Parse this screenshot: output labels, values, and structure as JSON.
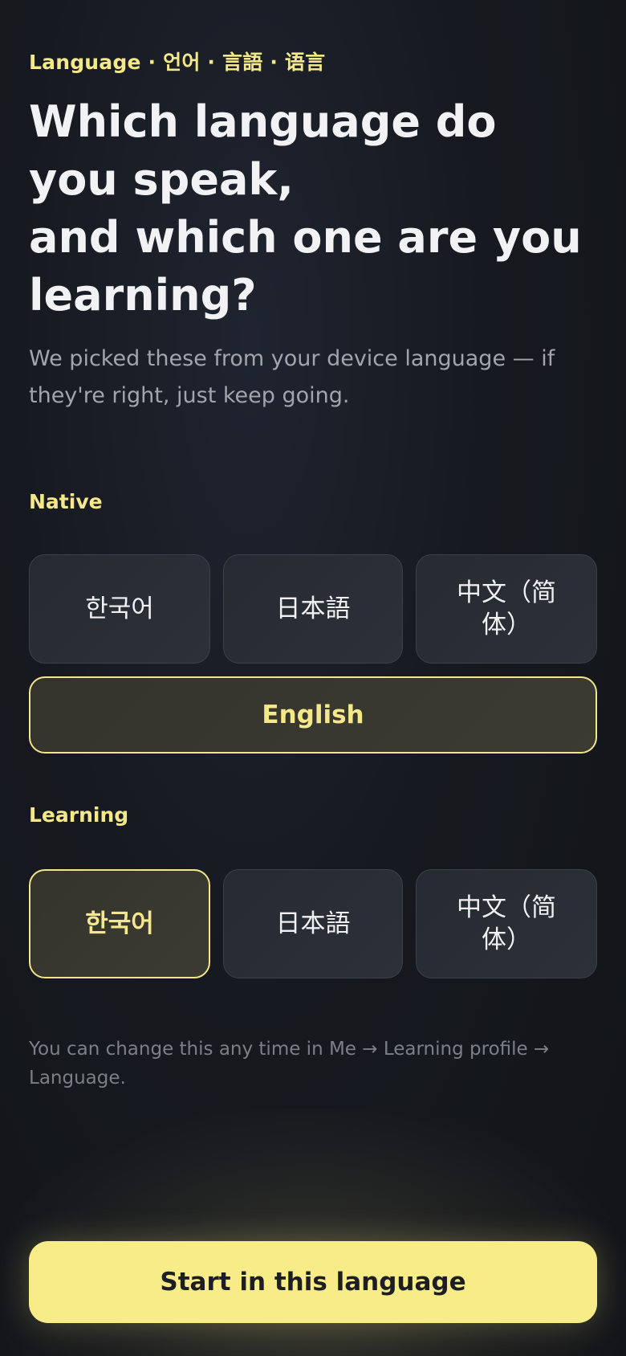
{
  "eyebrow": "Language · 언어 · 言語 · 语言",
  "headline": {
    "line1": "Which language do you speak,",
    "line2": "and which one are you learning?"
  },
  "subtitle": "We picked these from your device language — if they're right, just keep going.",
  "native": {
    "label": "Native",
    "options": [
      {
        "label": "한국어",
        "selected": false
      },
      {
        "label": "日本語",
        "selected": false
      },
      {
        "label": "中文（简体）",
        "selected": false
      },
      {
        "label": "English",
        "selected": true
      }
    ]
  },
  "learning": {
    "label": "Learning",
    "options": [
      {
        "label": "한국어",
        "selected": true
      },
      {
        "label": "日本語",
        "selected": false
      },
      {
        "label": "中文（简体）",
        "selected": false
      }
    ]
  },
  "note": "You can change this any time in Me → Learning profile → Language.",
  "cta_label": "Start in this language",
  "colors": {
    "accent": "#f5e88a",
    "background": "#16191f",
    "button_primary": "#f8ec88"
  }
}
